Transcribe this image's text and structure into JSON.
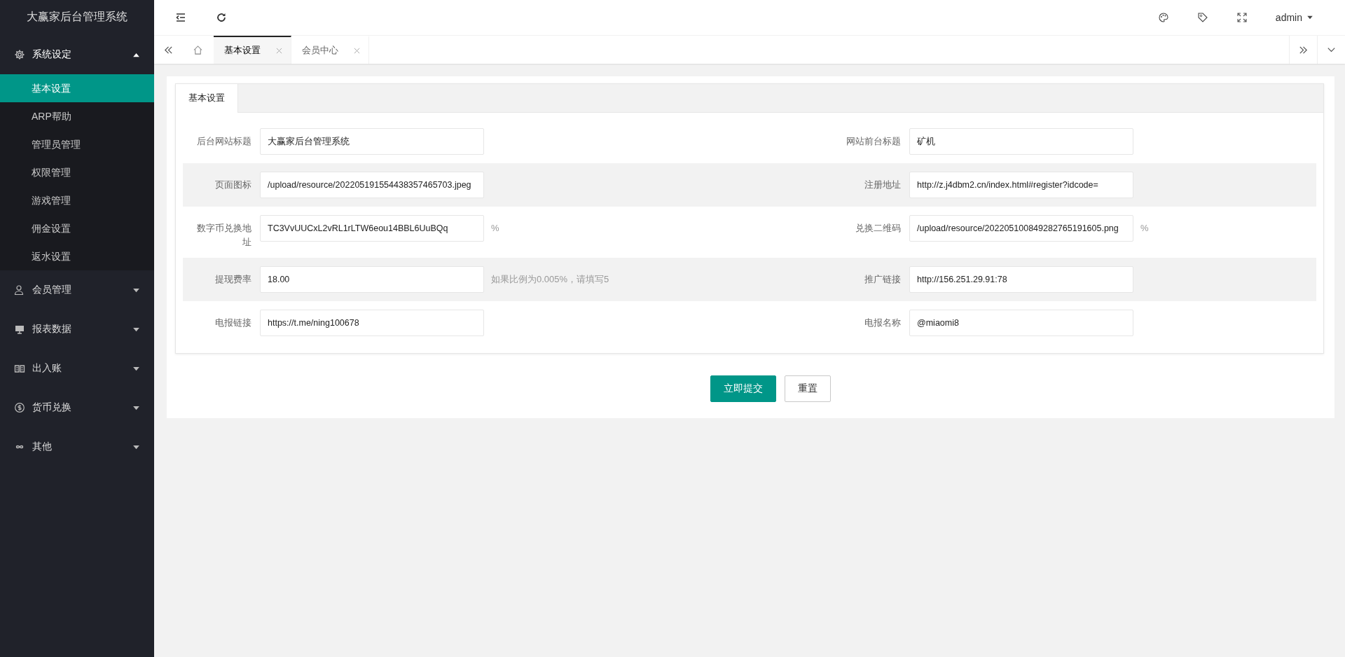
{
  "sidebar": {
    "title": "大赢家后台管理系统",
    "menu": [
      {
        "label": "系统设定",
        "expanded": true,
        "children": [
          {
            "label": "基本设置",
            "selected": true
          },
          {
            "label": "ARP帮助",
            "selected": false
          },
          {
            "label": "管理员管理",
            "selected": false
          },
          {
            "label": "权限管理",
            "selected": false
          },
          {
            "label": "游戏管理",
            "selected": false
          },
          {
            "label": "佣金设置",
            "selected": false
          },
          {
            "label": "返水设置",
            "selected": false
          }
        ]
      },
      {
        "label": "会员管理",
        "expanded": false
      },
      {
        "label": "报表数据",
        "expanded": false
      },
      {
        "label": "出入账",
        "expanded": false
      },
      {
        "label": "货币兑换",
        "expanded": false
      },
      {
        "label": "其他",
        "expanded": false
      }
    ]
  },
  "header": {
    "user": "admin"
  },
  "tabs": [
    {
      "label": "基本设置",
      "selected": true
    },
    {
      "label": "会员中心",
      "selected": false
    }
  ],
  "form": {
    "tab": "基本设置",
    "rows": [
      {
        "left": {
          "label": "后台网站标题",
          "value": "大赢家后台管理系统"
        },
        "right": {
          "label": "网站前台标题",
          "value": "矿机"
        }
      },
      {
        "left": {
          "label": "页面图标",
          "value": "/upload/resource/202205191554438357465703.jpeg"
        },
        "right": {
          "label": "注册地址",
          "value": "http://z.j4dbm2.cn/index.html#register?idcode="
        }
      },
      {
        "left": {
          "label": "数字币兑换地址",
          "value": "TC3VvUUCxL2vRL1rLTW6eou14BBL6UuBQq",
          "suffix": "%"
        },
        "right": {
          "label": "兑换二维码",
          "value": "/upload/resource/202205100849282765191605.png",
          "suffix": "%"
        }
      },
      {
        "left": {
          "label": "提现费率",
          "value": "18.00",
          "hint": "如果比例为0.005%，请填写5"
        },
        "right": {
          "label": "推广链接",
          "value": "http://156.251.29.91:78"
        }
      },
      {
        "left": {
          "label": "电报链接",
          "value": "https://t.me/ning100678"
        },
        "right": {
          "label": "电报名称",
          "value": "@miaomi8"
        }
      }
    ],
    "buttons": [
      {
        "label": "立即提交",
        "kind": "primary"
      },
      {
        "label": "重置",
        "kind": "plain"
      }
    ]
  }
}
